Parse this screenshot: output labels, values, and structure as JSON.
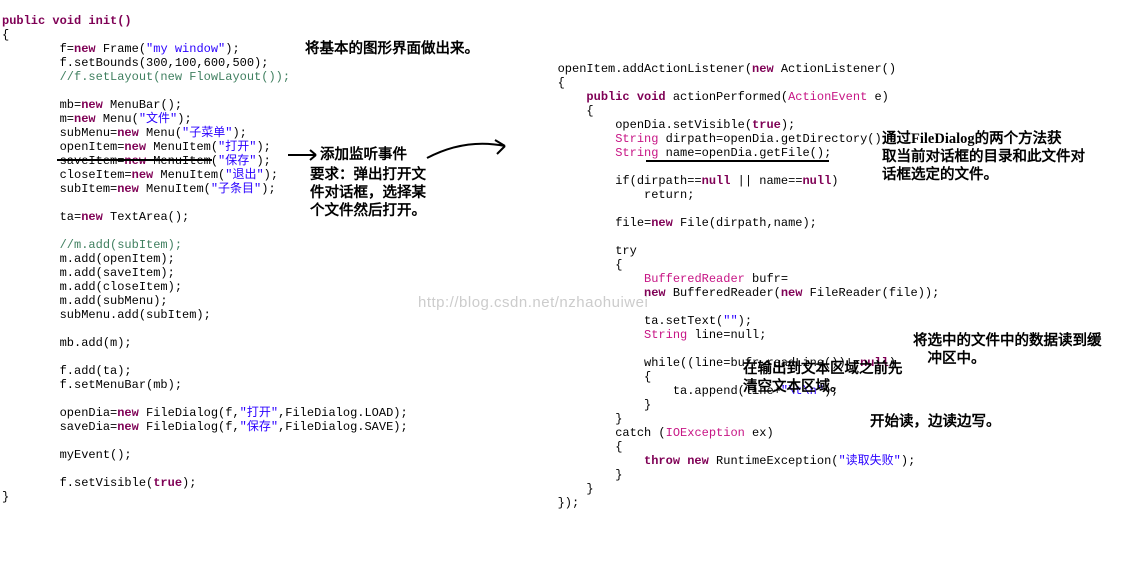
{
  "left": {
    "sig": "public void init()",
    "b1": "{",
    "l1a": "        f=",
    "l1b": "new",
    "l1c": " Frame(",
    "l1d": "\"my window\"",
    "l1e": ");",
    "l2": "        f.setBounds(300,100,600,500);",
    "l3": "        //f.setLayout(new FlowLayout());",
    "l4a": "        mb=",
    "l4b": "new",
    "l4c": " MenuBar();",
    "l5a": "        m=",
    "l5b": "new",
    "l5c": " Menu(",
    "l5d": "\"文件\"",
    "l5e": ");",
    "l6a": "        subMenu=",
    "l6b": "new",
    "l6c": " Menu(",
    "l6d": "\"子菜单\"",
    "l6e": ");",
    "l7a": "        openItem=",
    "l7b": "new",
    "l7c": " MenuItem(",
    "l7d": "\"打开\"",
    "l7e": ");",
    "l8a": "        saveItem=",
    "l8b": "new",
    "l8c": " MenuItem(",
    "l8d": "\"保存\"",
    "l8e": ");",
    "l9a": "        closeItem=",
    "l9b": "new",
    "l9c": " MenuItem(",
    "l9d": "\"退出\"",
    "l9e": ");",
    "l10a": "        subItem=",
    "l10b": "new",
    "l10c": " MenuItem(",
    "l10d": "\"子条目\"",
    "l10e": ");",
    "l11a": "        ta=",
    "l11b": "new",
    "l11c": " TextArea();",
    "l12": "        //m.add(subItem);",
    "l13": "        m.add(openItem);",
    "l14": "        m.add(saveItem);",
    "l15": "        m.add(closeItem);",
    "l16": "        m.add(subMenu);",
    "l17": "        subMenu.add(subItem);",
    "l18": "        mb.add(m);",
    "l19": "        f.add(ta);",
    "l20": "        f.setMenuBar(mb);",
    "l21a": "        openDia=",
    "l21b": "new",
    "l21c": " FileDialog(f,",
    "l21d": "\"打开\"",
    "l21e": ",FileDialog.LOAD);",
    "l22a": "        saveDia=",
    "l22b": "new",
    "l22c": " FileDialog(f,",
    "l22d": "\"保存\"",
    "l22e": ",FileDialog.SAVE);",
    "l23": "        myEvent();",
    "l24a": "        f.setVisible(",
    "l24b": "true",
    "l24c": ");",
    "b2": "}"
  },
  "right": {
    "r1a": "        openItem.addActionListener(",
    "r1b": "new",
    "r1c": " ActionListener()",
    "r2": "        {",
    "r3a": "            public void",
    "r3b": " actionPerformed(",
    "r3c": "ActionEvent",
    "r3d": " e)",
    "r4": "            {",
    "r5a": "                openDia.setVisible(",
    "r5b": "true",
    "r5c": ");",
    "r6a": "                ",
    "r6b": "String",
    "r6c": " dirpath=openDia.getDirectory();",
    "r7a": "                ",
    "r7b": "String",
    "r7c": " name=openDia.getFile();",
    "r8a": "                if(dirpath==",
    "r8b": "null",
    "r8c": " || name==",
    "r8d": "null",
    "r8e": ")",
    "r9": "                    return;",
    "r10a": "                file=",
    "r10b": "new",
    "r10c": " File(dirpath,name);",
    "r11": "                try",
    "r12": "                {",
    "r13a": "                    ",
    "r13b": "BufferedReader",
    "r13c": " bufr=",
    "r14a": "                    ",
    "r14b": "new",
    "r14c": " BufferedReader(",
    "r14d": "new",
    "r14e": " FileReader(file));",
    "r15a": "                    ta.setText(",
    "r15b": "\"\"",
    "r15c": ");",
    "r16a": "                    ",
    "r16b": "String",
    "r16c": " line=null;",
    "r17a": "                    while((line=bufr.readLine())!=",
    "r17b": "null",
    "r17c": ")",
    "r18": "                    {",
    "r19a": "                        ta.append(line+",
    "r19b": "\"\\t\\n\"",
    "r19c": ");",
    "r20": "                    }",
    "r21": "                }",
    "r22a": "                catch (",
    "r22b": "IOException",
    "r22c": " ex)",
    "r23": "                {",
    "r24a": "                    throw ",
    "r24b": "new",
    "r24c": " RuntimeException(",
    "r24d": "\"读取失败\"",
    "r24e": ");",
    "r25": "                }",
    "r26": "            }",
    "r27": "        });"
  },
  "ann": {
    "a1": "将基本的图形界面做出来。",
    "a2": "添加监听事件",
    "a3": "要求：弹出打开文\n件对话框，选择某\n个文件然后打开。",
    "a4": "通过FileDialog的两个方法获\n取当前对话框的目录和此文件对\n话框选定的文件。",
    "a5": "将选中的文件中的数据读到缓\n    冲区中。",
    "a6": "在输出到文本区域之前先\n清空文本区域。",
    "a7": "开始读，边读边写。",
    "wm": "http://blog.csdn.net/nzhaohuiwei"
  }
}
